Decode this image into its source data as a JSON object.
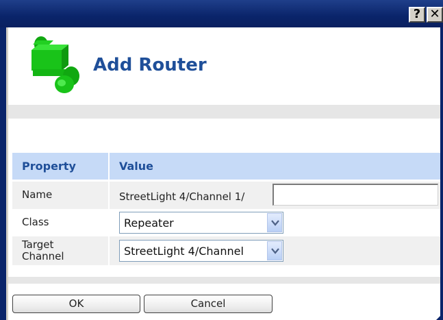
{
  "window": {
    "help_glyph": "?",
    "close_glyph": "✕"
  },
  "header": {
    "title": "Add Router",
    "icon": "router-icon"
  },
  "table": {
    "columns": [
      "Property",
      "Value"
    ],
    "rows": {
      "name": {
        "label": "Name",
        "prefix": "StreetLight 4/Channel 1/",
        "value": ""
      },
      "class": {
        "label": "Class",
        "value": "Repeater"
      },
      "target": {
        "label_line1": "Target",
        "label_line2": "Channel",
        "value": "StreetLight 4/Channel"
      }
    }
  },
  "buttons": {
    "ok": "OK",
    "cancel": "Cancel"
  },
  "colors": {
    "titlebar": "#0a246a",
    "accent_text": "#1f4f99",
    "header_row": "#c6daf7",
    "icon_green": "#19c319"
  }
}
